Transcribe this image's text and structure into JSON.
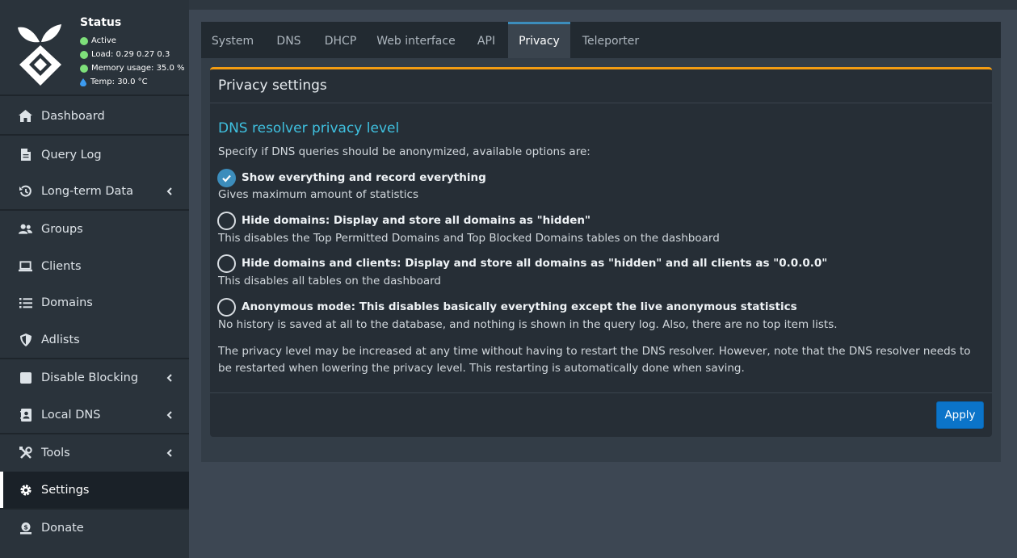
{
  "status": {
    "title": "Status",
    "active": "Active",
    "load": "Load:  0.29  0.27  0.3",
    "memory": "Memory usage:  35.0 %",
    "temp": "Temp: 30.0 °C"
  },
  "sidebar": {
    "items": [
      {
        "label": "Dashboard",
        "icon": "home-icon"
      },
      {
        "label": "Query Log",
        "icon": "file-icon"
      },
      {
        "label": "Long-term Data",
        "icon": "history-icon"
      },
      {
        "label": "Groups",
        "icon": "users-icon"
      },
      {
        "label": "Clients",
        "icon": "laptop-icon"
      },
      {
        "label": "Domains",
        "icon": "list-icon"
      },
      {
        "label": "Adlists",
        "icon": "shield-icon"
      },
      {
        "label": "Disable Blocking",
        "icon": "stop-icon"
      },
      {
        "label": "Local DNS",
        "icon": "address-book-icon"
      },
      {
        "label": "Tools",
        "icon": "tools-icon"
      },
      {
        "label": "Settings",
        "icon": "gear-icon"
      },
      {
        "label": "Donate",
        "icon": "donate-icon"
      }
    ]
  },
  "tabs": [
    "System",
    "DNS",
    "DHCP",
    "Web interface",
    "API",
    "Privacy",
    "Teleporter"
  ],
  "privacy": {
    "box_title": "Privacy settings",
    "section_title": "DNS resolver privacy level",
    "intro": "Specify if DNS queries should be anonymized, available options are:",
    "options": [
      {
        "label": "Show everything and record everything",
        "desc": "Gives maximum amount of statistics",
        "checked": true
      },
      {
        "label": "Hide domains: Display and store all domains as \"hidden\"",
        "desc": "This disables the Top Permitted Domains and Top Blocked Domains tables on the dashboard",
        "checked": false
      },
      {
        "label": "Hide domains and clients: Display and store all domains as \"hidden\" and all clients as \"0.0.0.0\"",
        "desc": "This disables all tables on the dashboard",
        "checked": false
      },
      {
        "label": "Anonymous mode: This disables basically everything except the live anonymous statistics",
        "desc": "No history is saved at all to the database, and nothing is shown in the query log. Also, there are no top item lists.",
        "checked": false
      }
    ],
    "note": "The privacy level may be increased at any time without having to restart the DNS resolver. However, note that the DNS resolver needs to be restarted when lowering the privacy level. This restarting is automatically done when saving.",
    "apply_label": "Apply"
  },
  "colors": {
    "accent": "#3c8dbc",
    "warning_border": "#f39c12",
    "section_title": "#3fc1e0",
    "apply_button": "#0b74c9",
    "status_dot": "#7ee07a"
  }
}
